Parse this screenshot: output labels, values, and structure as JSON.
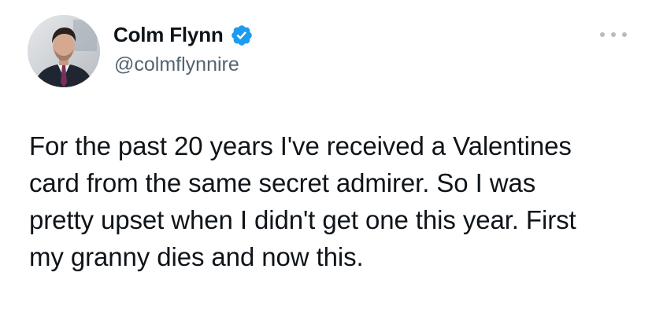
{
  "author": {
    "display_name": "Colm Flynn",
    "handle": "@colmflynnire",
    "verified": true,
    "avatar_icon": "profile-photo",
    "verified_icon": "verified-badge-icon",
    "verified_color": "#1d9bf0"
  },
  "menu": {
    "icon": "more-options-icon"
  },
  "tweet": {
    "text": "For the past 20 years I've received a Valentines\ncard from the same secret admirer. So I was\npretty upset when I didn't get one this year. First\nmy granny dies and now this."
  },
  "colors": {
    "text_primary": "#0f1419",
    "text_secondary": "#536471",
    "background": "#ffffff"
  }
}
